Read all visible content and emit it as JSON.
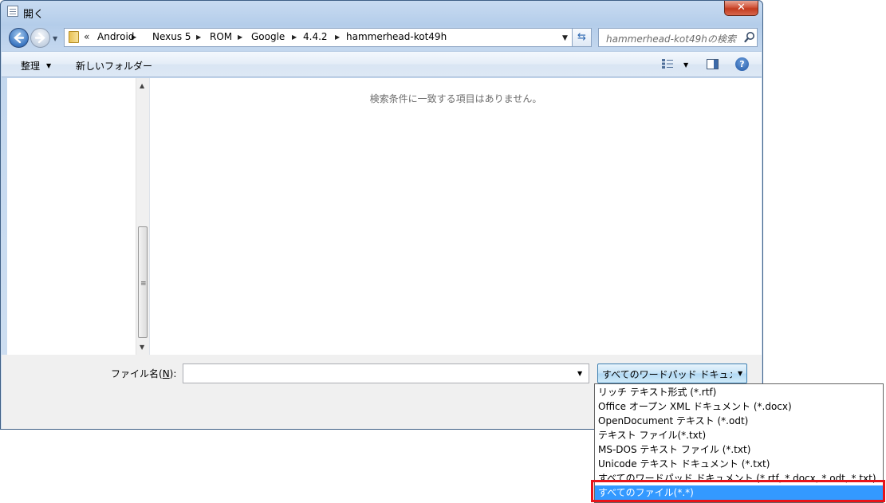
{
  "window": {
    "title": "開く",
    "close_label": "✕"
  },
  "address": {
    "overflow": "«",
    "crumbs": [
      "Android",
      "Nexus 5",
      "ROM",
      "Google",
      "4.4.2",
      "hammerhead-kot49h"
    ]
  },
  "search": {
    "placeholder": "hammerhead-kot49hの検索"
  },
  "toolbar": {
    "organize_label": "整理",
    "new_folder_label": "新しいフォルダー",
    "help_label": "?"
  },
  "file_list": {
    "empty_message": "検索条件に一致する項目はありません。"
  },
  "bottom": {
    "filename_label_prefix": "ファイル名(",
    "filename_label_key": "N",
    "filename_label_suffix": "):",
    "filename_value": "",
    "filetype_selected": "すべてのワードパッド ドキュメント"
  },
  "filetype_options": [
    {
      "label": "リッチ テキスト形式 (*.rtf)",
      "selected": false
    },
    {
      "label": "Office オープン XML ドキュメント (*.docx)",
      "selected": false
    },
    {
      "label": "OpenDocument テキスト (*.odt)",
      "selected": false
    },
    {
      "label": "テキスト ファイル(*.txt)",
      "selected": false
    },
    {
      "label": "MS-DOS テキスト ファイル (*.txt)",
      "selected": false
    },
    {
      "label": "Unicode テキスト ドキュメント (*.txt)",
      "selected": false
    },
    {
      "label": "すべてのワードパッド ドキュメント (*.rtf, *.docx, *.odt, *.txt)",
      "selected": false
    },
    {
      "label": "すべてのファイル(*.*)",
      "selected": true
    }
  ],
  "colors": {
    "selection": "#3399ff",
    "highlight_outline": "#e8141a"
  }
}
